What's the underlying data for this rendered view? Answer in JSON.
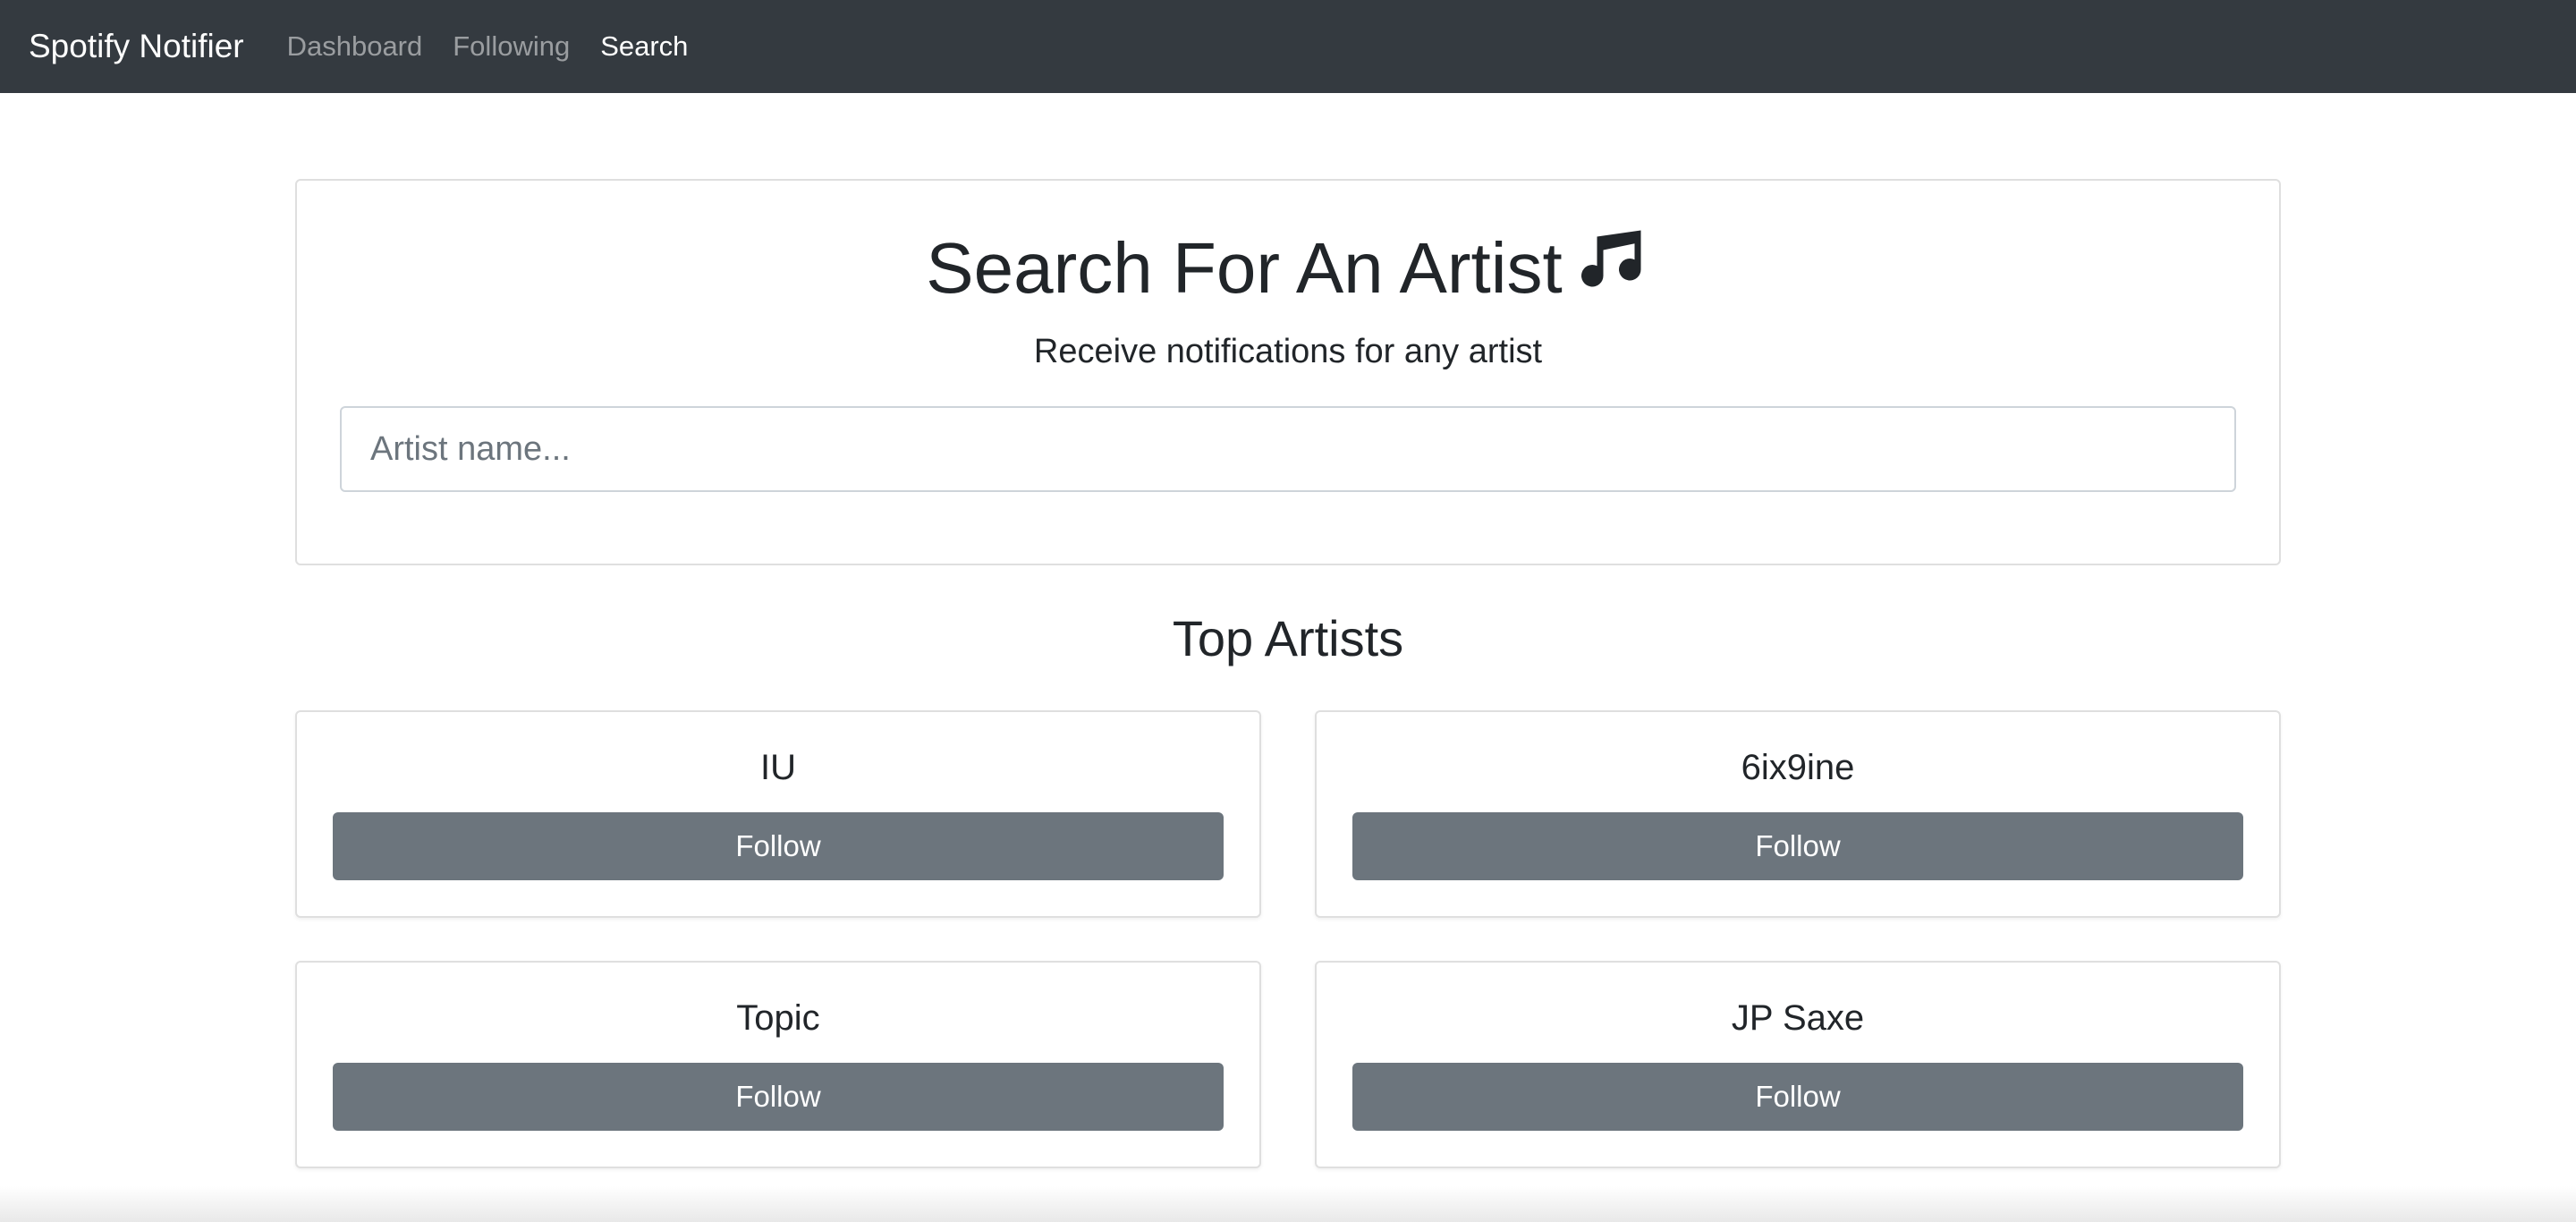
{
  "navbar": {
    "brand": "Spotify Notifier",
    "links": [
      {
        "label": "Dashboard",
        "active": false
      },
      {
        "label": "Following",
        "active": false
      },
      {
        "label": "Search",
        "active": true
      }
    ]
  },
  "search": {
    "title": "Search For An Artist",
    "title_icon": "music-note-icon",
    "subtitle": "Receive notifications for any artist",
    "input_value": "",
    "placeholder": "Artist name..."
  },
  "top_artists": {
    "title": "Top Artists",
    "artists": [
      {
        "name": "IU",
        "button_label": "Follow"
      },
      {
        "name": "6ix9ine",
        "button_label": "Follow"
      },
      {
        "name": "Topic",
        "button_label": "Follow"
      },
      {
        "name": "JP Saxe",
        "button_label": "Follow"
      }
    ]
  },
  "colors": {
    "navbar_bg": "#343a40",
    "button_bg": "#6c757d",
    "text": "#212529"
  }
}
